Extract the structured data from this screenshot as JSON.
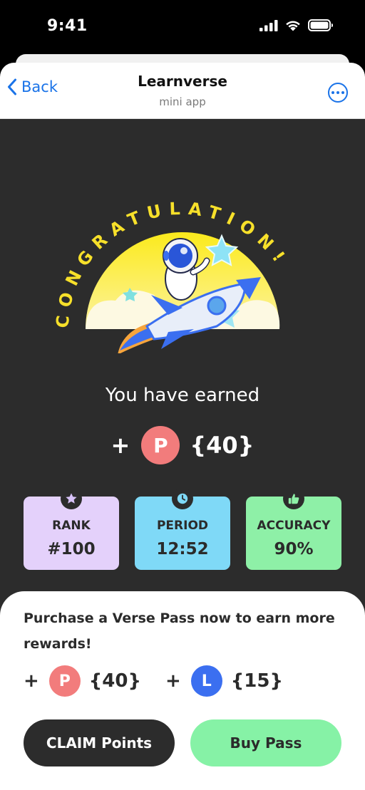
{
  "status_bar": {
    "time": "9:41"
  },
  "nav": {
    "back_label": "Back",
    "title": "Learnverse",
    "subtitle": "mini app"
  },
  "illustration": {
    "headline": "CONGRATULATION!"
  },
  "earned": {
    "label": "You have earned",
    "plus": "+",
    "points_symbol": "P",
    "points_value": "{40}"
  },
  "stats": [
    {
      "label": "RANK",
      "value": "#100",
      "icon": "star-icon",
      "color": "#e4d1fb"
    },
    {
      "label": "PERIOD",
      "value": "12:52",
      "icon": "clock-icon",
      "color": "#7fd9f7"
    },
    {
      "label": "ACCURACY",
      "value": "90%",
      "icon": "thumbs-up-icon",
      "color": "#8ef0a7"
    }
  ],
  "promo": {
    "text": "Purchase a Verse Pass now to earn more rewards!",
    "plus": "+",
    "points_symbol": "P",
    "points_value": "{40}",
    "learn_symbol": "L",
    "learn_value": "{15}"
  },
  "buttons": {
    "claim_label": "CLAIM Points",
    "buy_label": "Buy Pass"
  },
  "colors": {
    "accent_blue": "#1a73e8",
    "background_dark": "#2c2c2c",
    "points_coin": "#f27c7c",
    "learn_coin": "#3b6ff0",
    "buy_button": "#86f2a6",
    "headline_yellow": "#f7e02a"
  }
}
